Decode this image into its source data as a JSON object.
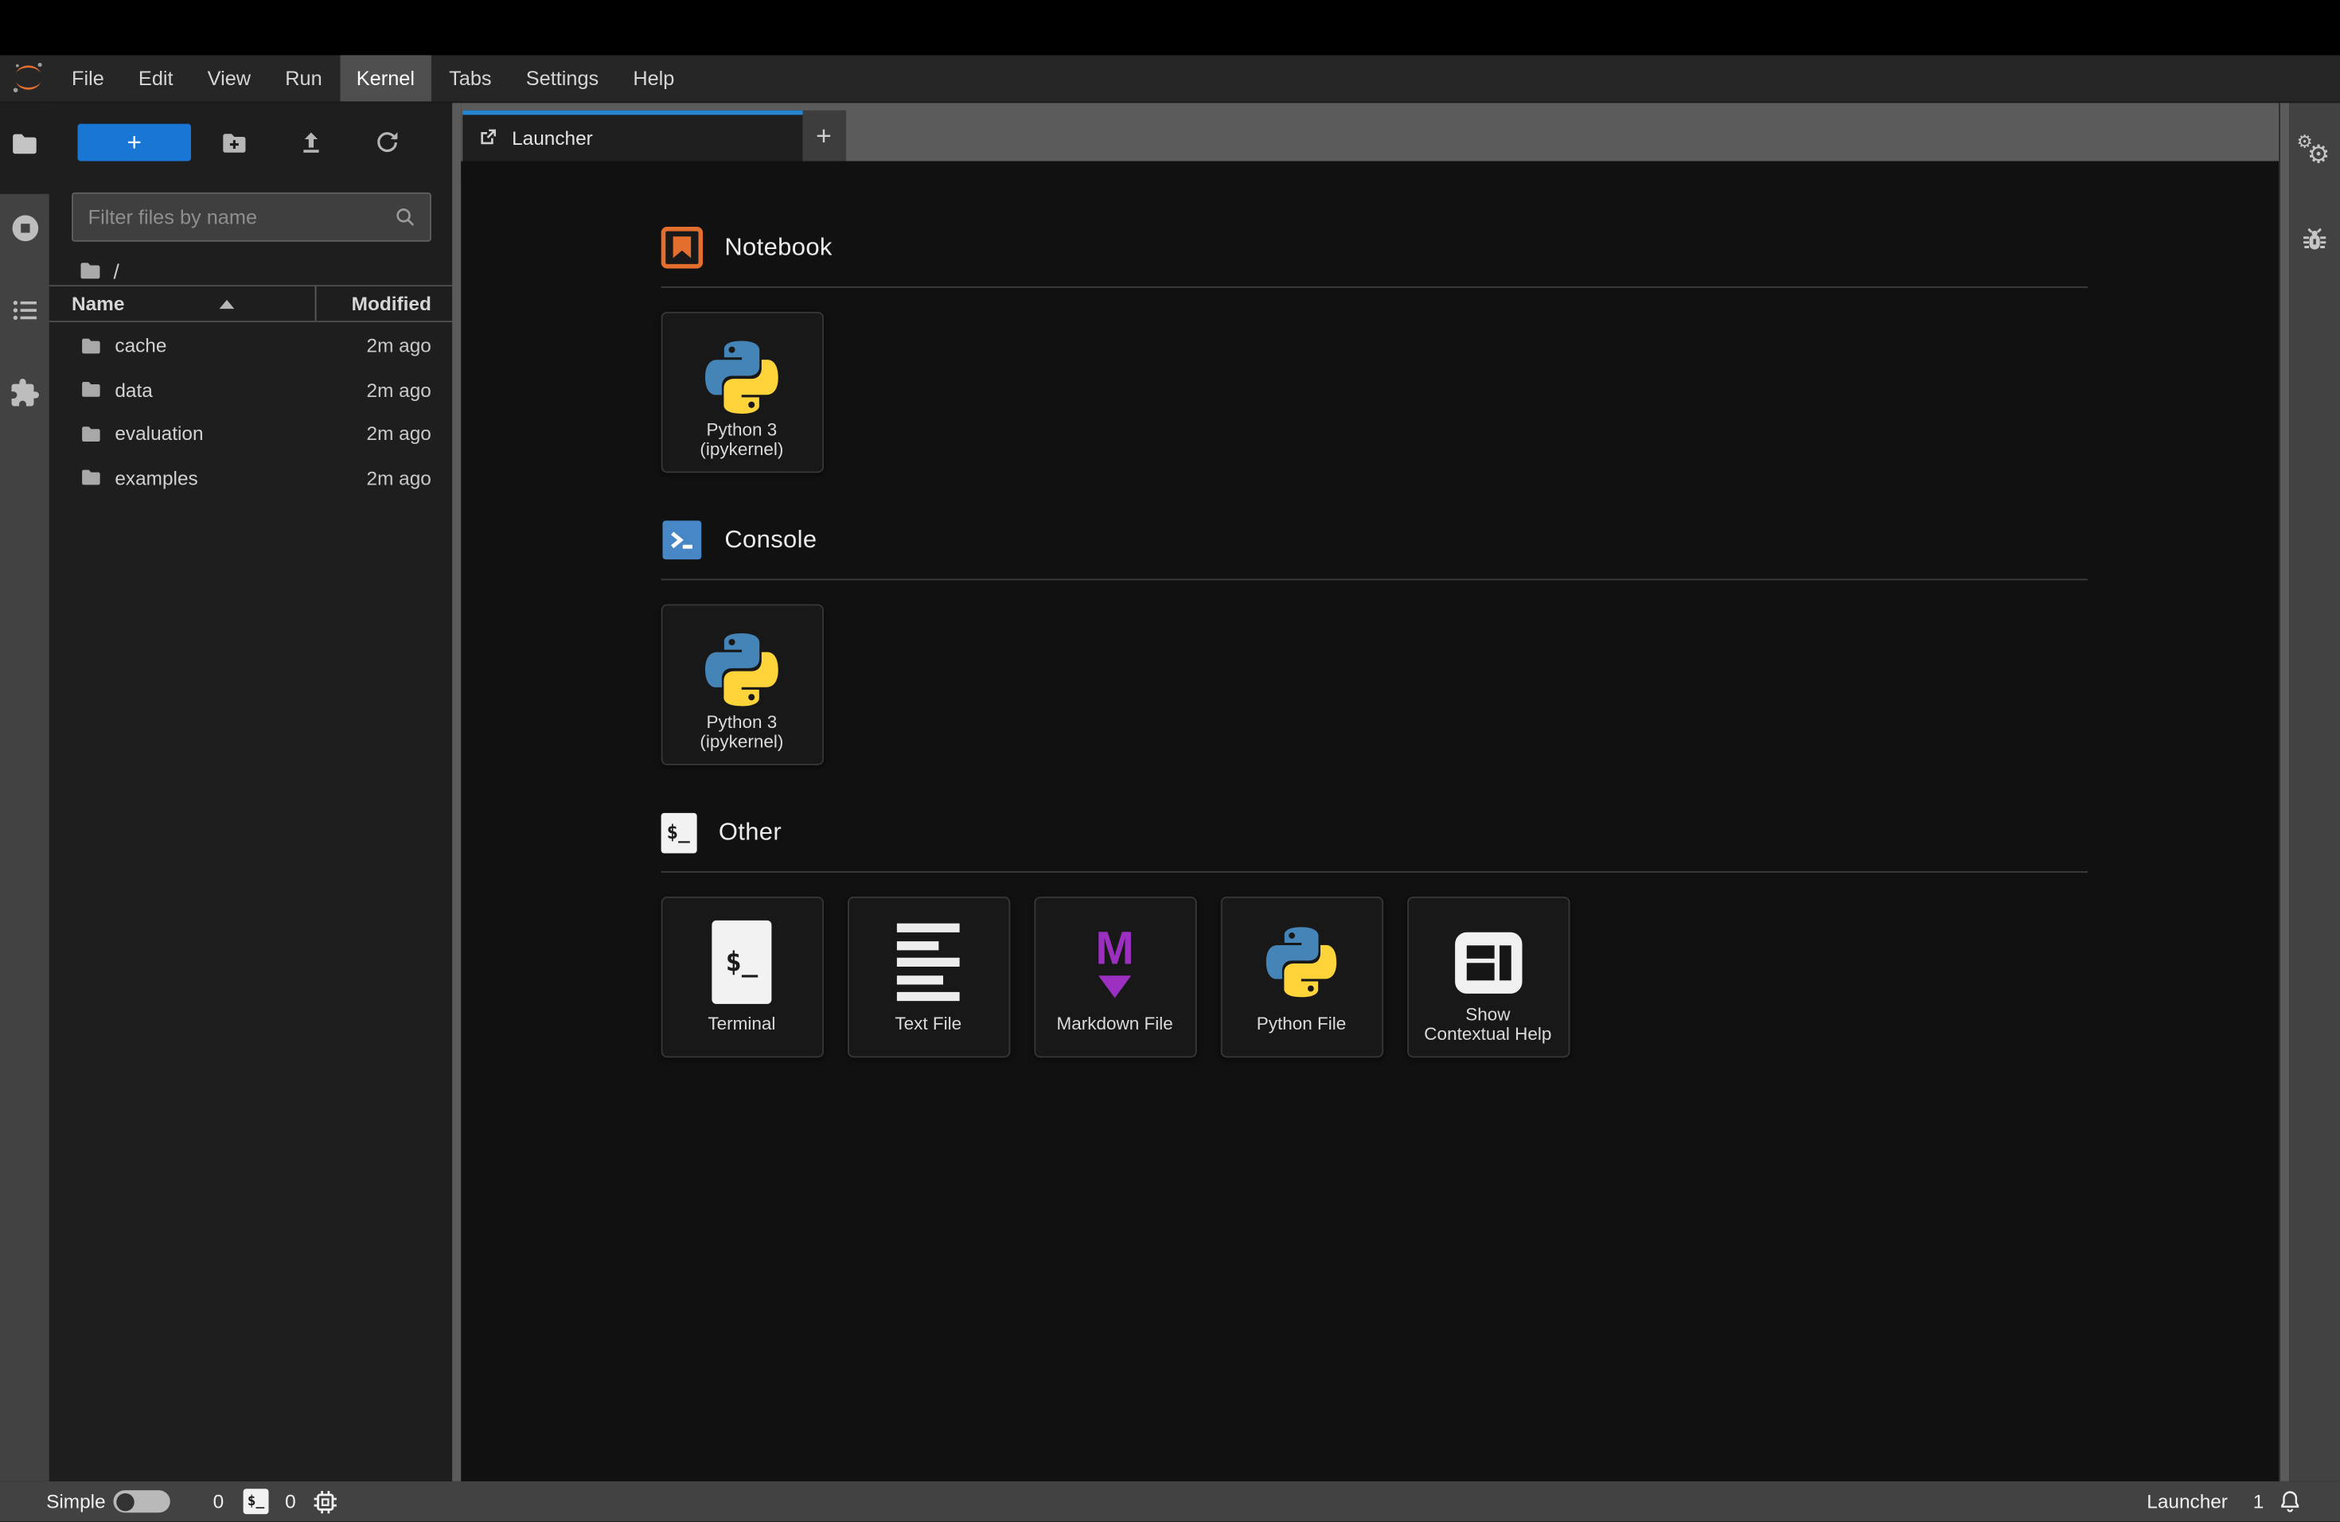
{
  "colors": {
    "accent_blue": "#1976d2",
    "tab_blue": "#2685d0",
    "notebook_orange": "#e46e2e",
    "console_blue": "#4887c5",
    "markdown_purple": "#9b2fc0",
    "python_blue": "#4584b6",
    "python_yellow": "#ffd43b"
  },
  "glyphs": {
    "terminal_prompt": "$_",
    "markdown_m": "M"
  },
  "menu_bar": {
    "items": [
      "File",
      "Edit",
      "View",
      "Run",
      "Kernel",
      "Tabs",
      "Settings",
      "Help"
    ],
    "active_item": "Kernel"
  },
  "left_activity_bar": {
    "items": [
      "file-browser",
      "running-terminals-and-kernels",
      "table-of-contents",
      "extension-manager"
    ],
    "active": "file-browser"
  },
  "right_activity_bar": {
    "items": [
      "property-inspector",
      "debugger"
    ]
  },
  "file_browser": {
    "new_launcher_label": "+",
    "toolbar_icons": [
      "new-folder",
      "upload",
      "refresh"
    ],
    "filter_placeholder": "Filter files by name",
    "breadcrumb_root": "/",
    "columns": {
      "name": "Name",
      "modified": "Modified"
    },
    "sort": {
      "column": "Name",
      "direction": "ascending"
    },
    "files": [
      {
        "name": "cache",
        "modified": "2m ago"
      },
      {
        "name": "data",
        "modified": "2m ago"
      },
      {
        "name": "evaluation",
        "modified": "2m ago"
      },
      {
        "name": "examples",
        "modified": "2m ago"
      }
    ]
  },
  "dock": {
    "tab_label": "Launcher",
    "new_tab_label": "+"
  },
  "launcher": {
    "sections": [
      {
        "title": "Notebook",
        "icon": "notebook",
        "cards": [
          {
            "lines": [
              "Python 3",
              "(ipykernel)"
            ],
            "icon": "python-logo"
          }
        ]
      },
      {
        "title": "Console",
        "icon": "console",
        "cards": [
          {
            "lines": [
              "Python 3",
              "(ipykernel)"
            ],
            "icon": "python-logo"
          }
        ]
      },
      {
        "title": "Other",
        "icon": "terminal",
        "cards": [
          {
            "lines": [
              "Terminal"
            ],
            "icon": "terminal"
          },
          {
            "lines": [
              "Text File"
            ],
            "icon": "text-file"
          },
          {
            "lines": [
              "Markdown File"
            ],
            "icon": "markdown"
          },
          {
            "lines": [
              "Python File"
            ],
            "icon": "python-logo"
          },
          {
            "lines": [
              "Show",
              "Contextual Help"
            ],
            "icon": "contextual-help"
          }
        ]
      }
    ]
  },
  "status_bar": {
    "simple_label": "Simple",
    "simple_toggle_on": false,
    "terminals_count": "0",
    "kernels_count": "0",
    "context_label": "Launcher",
    "notifications_count": "1"
  }
}
